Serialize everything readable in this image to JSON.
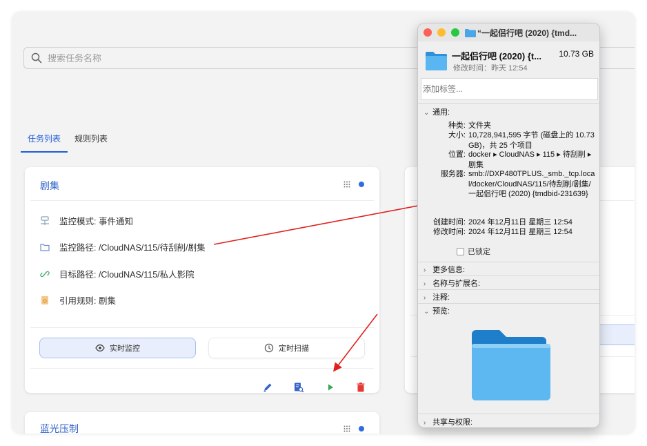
{
  "search": {
    "placeholder": "搜索任务名称"
  },
  "tabs": [
    {
      "label": "任务列表"
    },
    {
      "label": "规则列表"
    }
  ],
  "cards": [
    {
      "title": "剧集",
      "rows": [
        {
          "label": "监控模式: 事件通知"
        },
        {
          "label": "监控路径: /CloudNAS/115/待刮削/剧集"
        },
        {
          "label": "目标路径: /CloudNAS/115/私人影院"
        },
        {
          "label": "引用规则: 剧集"
        }
      ],
      "buttons": {
        "realtime": "实时监控",
        "scheduled": "定时扫描"
      }
    },
    {
      "title": "蓝光压制"
    }
  ],
  "info_window": {
    "title": "“一起侣行吧 (2020) {tmd...",
    "name": "一起侣行吧 (2020) {t...",
    "size": "10.73 GB",
    "modified_short": "修改时间：昨天 12:54",
    "tag_placeholder": "添加标签...",
    "general_label": "通用:",
    "kind_key": "种类:",
    "kind_val": "文件夹",
    "size_key": "大小:",
    "size_val": "10,728,941,595 字节 (磁盘上的 10.73 GB)，共 25 个项目",
    "where_key": "位置:",
    "where_val": "docker ▸ CloudNAS ▸ 115 ▸ 待刮削 ▸ 剧集",
    "server_key": "服务器:",
    "server_val": "smb://DXP480TPLUS._smb._tcp.local/docker/CloudNAS/115/待刮削/剧集/一起侣行吧 (2020) {tmdbid-231639}",
    "created_key": "创建时间:",
    "created_val": "2024 年12月11日 星期三 12:54",
    "modified_key": "修改时间:",
    "modified_val": "2024 年12月11日 星期三 12:54",
    "locked_label": "已锁定",
    "more_info": "更多信息:",
    "name_ext": "名称与扩展名:",
    "comments": "注释:",
    "preview": "预览:",
    "sharing": "共享与权限:"
  },
  "colors": {
    "accent": "#1e5ad8",
    "card_title": "#3264c8",
    "arrow": "#e02020"
  }
}
